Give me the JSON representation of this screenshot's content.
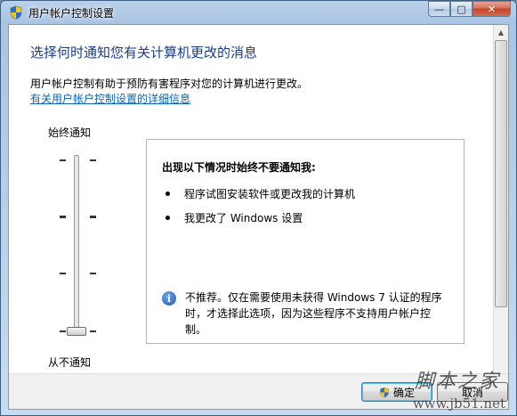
{
  "window": {
    "title": "用户帐户控制设置",
    "controls": {
      "minimize": "—",
      "maximize": "□",
      "close": "✕"
    }
  },
  "main": {
    "heading": "选择何时通知您有关计算机更改的消息",
    "description": "用户帐户控制有助于预防有害程序对您的计算机进行更改。",
    "link": "有关用户帐户控制设置的详细信息"
  },
  "slider": {
    "top_label": "始终通知",
    "bottom_label": "从不通知",
    "levels": 4,
    "selected_level": 0
  },
  "info": {
    "title": "出现以下情况时始终不要通知我:",
    "bullets": [
      "程序试图安装软件或更改我的计算机",
      "我更改了 Windows 设置"
    ],
    "note": "不推荐。仅在需要使用未获得 Windows 7 认证的程序时，才选择此选项，因为这些程序不支持用户帐户控制。",
    "note_icon": "info-icon"
  },
  "buttons": {
    "ok": "确定",
    "cancel": "取消"
  },
  "watermark": {
    "text": "脚本之家",
    "url": "www.jb51.net"
  }
}
